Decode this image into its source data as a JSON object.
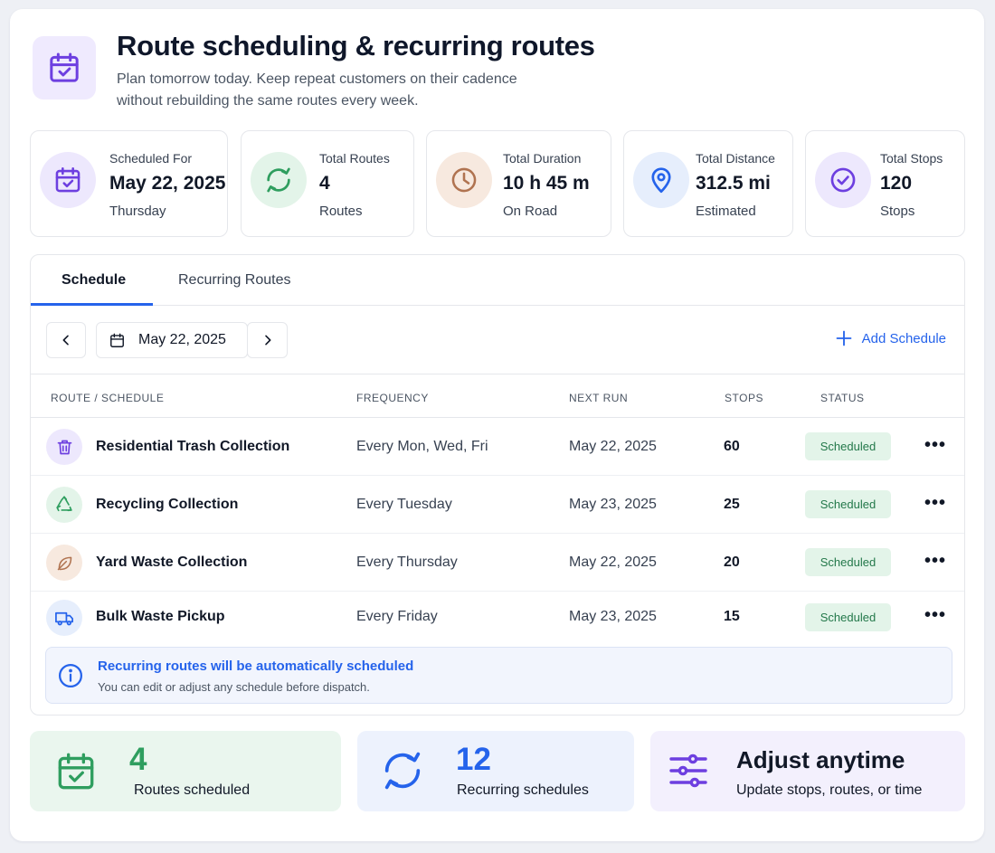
{
  "header": {
    "title": "Route scheduling & recurring routes",
    "subtitle_line1": "Plan tomorrow today. Keep repeat customers on their cadence",
    "subtitle_line2": "without rebuilding the same routes every week.",
    "icon": "calendar-check-icon"
  },
  "stats": [
    {
      "label": "Scheduled For",
      "value": "May 22, 2025",
      "sub": "Thursday",
      "icon": "calendar-check-icon",
      "color": "#6d3fe0"
    },
    {
      "label": "Total Routes",
      "value": "4",
      "sub": "Routes",
      "icon": "refresh-icon",
      "color": "#2f9e5f"
    },
    {
      "label": "Total Duration",
      "value": "10 h 45 m",
      "sub": "On Road",
      "icon": "clock-icon",
      "color": "#b07350"
    },
    {
      "label": "Total Distance",
      "value": "312.5 mi",
      "sub": "Estimated",
      "icon": "map-pin-icon",
      "color": "#2563eb"
    },
    {
      "label": "Total Stops",
      "value": "120",
      "sub": "Stops",
      "icon": "check-circle-icon",
      "color": "#6d3fe0"
    }
  ],
  "tabs": [
    {
      "label": "Schedule",
      "active": true
    },
    {
      "label": "Recurring Routes",
      "active": false
    }
  ],
  "toolbar": {
    "date": "May 22, 2025",
    "add_label": "Add Schedule"
  },
  "table": {
    "headers": [
      "ROUTE / SCHEDULE",
      "FREQUENCY",
      "NEXT RUN",
      "STOPS",
      "STATUS"
    ],
    "rows": [
      {
        "name": "Residential Trash Collection",
        "frequency": "Every Mon, Wed, Fri",
        "next_run": "May 22, 2025",
        "stops": "60",
        "status": "Scheduled",
        "icon": "trash-icon"
      },
      {
        "name": "Recycling Collection",
        "frequency": "Every Tuesday",
        "next_run": "May 23, 2025",
        "stops": "25",
        "status": "Scheduled",
        "icon": "recycle-icon"
      },
      {
        "name": "Yard Waste Collection",
        "frequency": "Every Thursday",
        "next_run": "May 22, 2025",
        "stops": "20",
        "status": "Scheduled",
        "icon": "leaf-icon"
      },
      {
        "name": "Bulk Waste Pickup",
        "frequency": "Every Friday",
        "next_run": "May 23, 2025",
        "stops": "15",
        "status": "Scheduled",
        "icon": "truck-icon"
      }
    ]
  },
  "info": {
    "title": "Recurring routes will be automatically scheduled",
    "subtitle": "You can edit or adjust any schedule before dispatch."
  },
  "summary": [
    {
      "value": "4",
      "label": "Routes scheduled",
      "icon": "calendar-check-icon",
      "color": "#2f9e5f"
    },
    {
      "value": "12",
      "label": "Recurring schedules",
      "icon": "refresh-icon",
      "color": "#2563eb"
    },
    {
      "value": "Adjust anytime",
      "label": "Update stops, routes, or time",
      "icon": "sliders-icon",
      "color": "#6d3fe0"
    }
  ]
}
